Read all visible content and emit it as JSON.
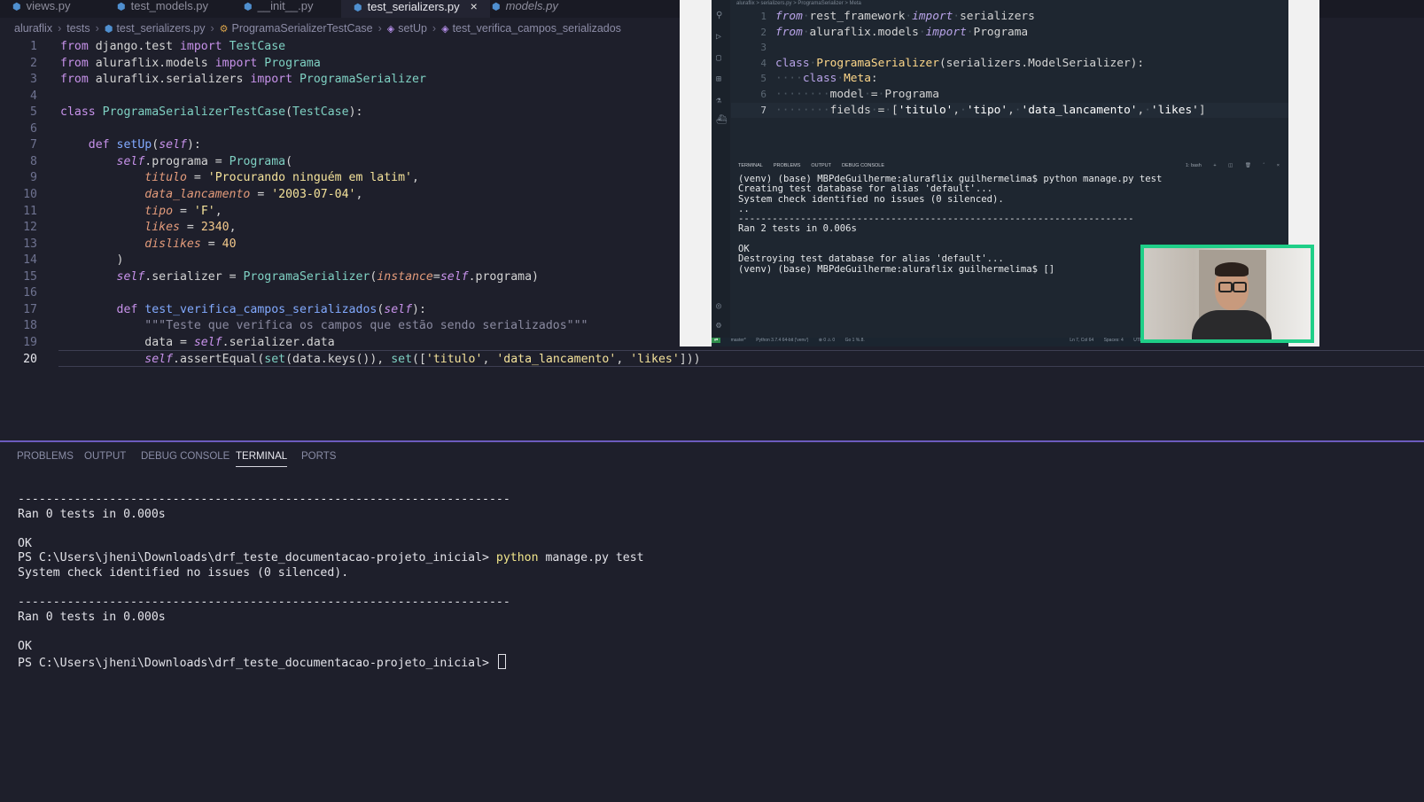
{
  "tabs": [
    {
      "label": "views.py",
      "state": "normal"
    },
    {
      "label": "test_models.py",
      "state": "normal"
    },
    {
      "label": "__init__.py",
      "state": "normal"
    },
    {
      "label": "test_serializers.py",
      "state": "active"
    },
    {
      "label": "models.py",
      "state": "preview"
    }
  ],
  "tab_close_symbol": "×",
  "breadcrumb": [
    "aluraflix",
    "tests",
    "test_serializers.py",
    "ProgramaSerializerTestCase",
    "setUp",
    "test_verifica_campos_serializados"
  ],
  "editor": {
    "current_line": "20",
    "lines": [
      {
        "n": "1",
        "tokens": [
          [
            "kw",
            "from"
          ],
          [
            "op",
            " django.test "
          ],
          [
            "kw",
            "import"
          ],
          [
            "op",
            " "
          ],
          [
            "cls",
            "TestCase"
          ]
        ]
      },
      {
        "n": "2",
        "tokens": [
          [
            "kw",
            "from"
          ],
          [
            "op",
            " aluraflix.models "
          ],
          [
            "kw",
            "import"
          ],
          [
            "op",
            " "
          ],
          [
            "cls",
            "Programa"
          ]
        ]
      },
      {
        "n": "3",
        "tokens": [
          [
            "kw",
            "from"
          ],
          [
            "op",
            " aluraflix.serializers "
          ],
          [
            "kw",
            "import"
          ],
          [
            "op",
            " "
          ],
          [
            "cls",
            "ProgramaSerializer"
          ]
        ]
      },
      {
        "n": "4",
        "tokens": []
      },
      {
        "n": "5",
        "tokens": [
          [
            "kw",
            "class"
          ],
          [
            "op",
            " "
          ],
          [
            "cls",
            "ProgramaSerializerTestCase"
          ],
          [
            "op",
            "("
          ],
          [
            "cls",
            "TestCase"
          ],
          [
            "op",
            "):"
          ]
        ]
      },
      {
        "n": "6",
        "tokens": []
      },
      {
        "n": "7",
        "tokens": [
          [
            "op",
            "    "
          ],
          [
            "kw",
            "def"
          ],
          [
            "op",
            " "
          ],
          [
            "fn",
            "setUp"
          ],
          [
            "op",
            "("
          ],
          [
            "selfc",
            "self"
          ],
          [
            "op",
            "):"
          ]
        ]
      },
      {
        "n": "8",
        "tokens": [
          [
            "op",
            "        "
          ],
          [
            "selfc",
            "self"
          ],
          [
            "op",
            ".programa = "
          ],
          [
            "cls",
            "Programa"
          ],
          [
            "op",
            "("
          ]
        ]
      },
      {
        "n": "9",
        "tokens": [
          [
            "op",
            "            "
          ],
          [
            "param",
            "titulo"
          ],
          [
            "op",
            " = "
          ],
          [
            "str",
            "'Procurando ninguém em latim'"
          ],
          [
            "op",
            ","
          ]
        ]
      },
      {
        "n": "10",
        "tokens": [
          [
            "op",
            "            "
          ],
          [
            "param",
            "data_lancamento"
          ],
          [
            "op",
            " = "
          ],
          [
            "str",
            "'2003-07-04'"
          ],
          [
            "op",
            ","
          ]
        ]
      },
      {
        "n": "11",
        "tokens": [
          [
            "op",
            "            "
          ],
          [
            "param",
            "tipo"
          ],
          [
            "op",
            " = "
          ],
          [
            "str",
            "'F'"
          ],
          [
            "op",
            ","
          ]
        ]
      },
      {
        "n": "12",
        "tokens": [
          [
            "op",
            "            "
          ],
          [
            "param",
            "likes"
          ],
          [
            "op",
            " = "
          ],
          [
            "num",
            "2340"
          ],
          [
            "op",
            ","
          ]
        ]
      },
      {
        "n": "13",
        "tokens": [
          [
            "op",
            "            "
          ],
          [
            "param",
            "dislikes"
          ],
          [
            "op",
            " = "
          ],
          [
            "num",
            "40"
          ]
        ]
      },
      {
        "n": "14",
        "tokens": [
          [
            "op",
            "        )"
          ]
        ]
      },
      {
        "n": "15",
        "tokens": [
          [
            "op",
            "        "
          ],
          [
            "selfc",
            "self"
          ],
          [
            "op",
            ".serializer = "
          ],
          [
            "cls",
            "ProgramaSerializer"
          ],
          [
            "op",
            "("
          ],
          [
            "param",
            "instance"
          ],
          [
            "op",
            "="
          ],
          [
            "selfc",
            "self"
          ],
          [
            "op",
            ".programa)"
          ]
        ]
      },
      {
        "n": "16",
        "tokens": []
      },
      {
        "n": "17",
        "tokens": [
          [
            "op",
            "        "
          ],
          [
            "kw",
            "def"
          ],
          [
            "op",
            " "
          ],
          [
            "fn",
            "test_verifica_campos_serializados"
          ],
          [
            "op",
            "("
          ],
          [
            "selfc",
            "self"
          ],
          [
            "op",
            "):"
          ]
        ]
      },
      {
        "n": "18",
        "tokens": [
          [
            "op",
            "            "
          ],
          [
            "doc",
            "\"\"\"Teste que verifica os campos que estão sendo serializados\"\"\""
          ]
        ]
      },
      {
        "n": "19",
        "tokens": [
          [
            "op",
            "            data = "
          ],
          [
            "selfc",
            "self"
          ],
          [
            "op",
            ".serializer.data"
          ]
        ]
      },
      {
        "n": "20",
        "tokens": [
          [
            "op",
            "            "
          ],
          [
            "selfc",
            "self"
          ],
          [
            "op",
            ".assertEqual("
          ],
          [
            "cls",
            "set"
          ],
          [
            "op",
            "(data.keys()), "
          ],
          [
            "cls",
            "set"
          ],
          [
            "op",
            "(["
          ],
          [
            "str",
            "'titulo'"
          ],
          [
            "op",
            ", "
          ],
          [
            "str",
            "'data_lancamento'"
          ],
          [
            "op",
            ", "
          ],
          [
            "str",
            "'likes'"
          ],
          [
            "op",
            "]))"
          ]
        ]
      }
    ]
  },
  "overlay": {
    "breadcrumb": "aluraflix > serializers.py > ProgramaSerializer > Meta",
    "code": [
      {
        "n": "1",
        "tokens": [
          [
            "o-kw",
            "from"
          ],
          [
            "o-dot",
            "·"
          ],
          [
            "op",
            "rest_framework"
          ],
          [
            "o-dot",
            "·"
          ],
          [
            "o-kw",
            "import"
          ],
          [
            "o-dot",
            "·"
          ],
          [
            "op",
            "serializers"
          ]
        ]
      },
      {
        "n": "2",
        "tokens": [
          [
            "o-kw",
            "from"
          ],
          [
            "o-dot",
            "·"
          ],
          [
            "op",
            "aluraflix.models"
          ],
          [
            "o-dot",
            "·"
          ],
          [
            "o-kw",
            "import"
          ],
          [
            "o-dot",
            "·"
          ],
          [
            "op",
            "Programa"
          ]
        ]
      },
      {
        "n": "3",
        "tokens": []
      },
      {
        "n": "4",
        "tokens": [
          [
            "o-kw2",
            "class"
          ],
          [
            "o-dot",
            "·"
          ],
          [
            "o-cls",
            "ProgramaSerializer"
          ],
          [
            "op",
            "(serializers.ModelSerializer):"
          ]
        ]
      },
      {
        "n": "5",
        "tokens": [
          [
            "o-dot",
            "····"
          ],
          [
            "o-kw2",
            "class"
          ],
          [
            "o-dot",
            "·"
          ],
          [
            "o-cls",
            "Meta"
          ],
          [
            "op",
            ":"
          ]
        ]
      },
      {
        "n": "6",
        "tokens": [
          [
            "o-dot",
            "········"
          ],
          [
            "op",
            "model"
          ],
          [
            "o-dot",
            "·"
          ],
          [
            "op",
            "="
          ],
          [
            "o-dot",
            "·"
          ],
          [
            "op",
            "Programa"
          ]
        ]
      },
      {
        "n": "7",
        "tokens": [
          [
            "o-dot",
            "········"
          ],
          [
            "op",
            "fields"
          ],
          [
            "o-dot",
            "·"
          ],
          [
            "op",
            "="
          ],
          [
            "o-dot",
            "·"
          ],
          [
            "op",
            "["
          ],
          [
            "o-str",
            "'titulo'"
          ],
          [
            "op",
            ","
          ],
          [
            "o-dot",
            "·"
          ],
          [
            "o-str",
            "'tipo'"
          ],
          [
            "op",
            ","
          ],
          [
            "o-dot",
            "·"
          ],
          [
            "o-str",
            "'data_lancamento'"
          ],
          [
            "op",
            ","
          ],
          [
            "o-dot",
            "·"
          ],
          [
            "o-str",
            "'likes'"
          ],
          [
            "op",
            "]"
          ]
        ]
      }
    ],
    "terminal_tabs": [
      "TERMINAL",
      "PROBLEMS",
      "OUTPUT",
      "DEBUG CONSOLE"
    ],
    "terminal_shell": "1: bash",
    "terminal_lines": [
      "(venv) (base) MBPdeGuilherme:aluraflix guilhermelima$ python manage.py test",
      "Creating test database for alias 'default'...",
      "System check identified no issues (0 silenced).",
      "..",
      "----------------------------------------------------------------------",
      "Ran 2 tests in 0.006s",
      "",
      "OK",
      "Destroying test database for alias 'default'...",
      "(venv) (base) MBPdeGuilherme:aluraflix guilhermelima$ []"
    ],
    "status": [
      "master*",
      "Python 3.7.4 64-bit ('venv')",
      "⊗ 0 ⚠ 0",
      "Go 1 %.8.",
      "Ln 7, Col 64",
      "Spaces: 4",
      "UTF-8"
    ]
  },
  "panel": {
    "tabs": [
      "PROBLEMS",
      "OUTPUT",
      "DEBUG CONSOLE",
      "TERMINAL",
      "PORTS"
    ],
    "active_tab": "TERMINAL"
  },
  "terminal": {
    "lines": [
      {
        "text": "----------------------------------------------------------------------"
      },
      {
        "text": "Ran 0 tests in 0.000s"
      },
      {
        "text": ""
      },
      {
        "text": "OK"
      },
      {
        "prompt": "PS C:\\Users\\jheni\\Downloads\\drf_teste_documentacao-projeto_inicial> ",
        "cmd": "python",
        "rest": " manage.py test"
      },
      {
        "text": "System check identified no issues (0 silenced)."
      },
      {
        "text": ""
      },
      {
        "text": "----------------------------------------------------------------------"
      },
      {
        "text": "Ran 0 tests in 0.000s"
      },
      {
        "text": ""
      },
      {
        "text": "OK"
      },
      {
        "prompt": "PS C:\\Users\\jheni\\Downloads\\drf_teste_documentacao-projeto_inicial> ",
        "cursor": true
      }
    ]
  },
  "colors": {
    "background": "#1e1f2b",
    "accent": "#6c5bbd",
    "webcam_border": "#1fcf88"
  }
}
